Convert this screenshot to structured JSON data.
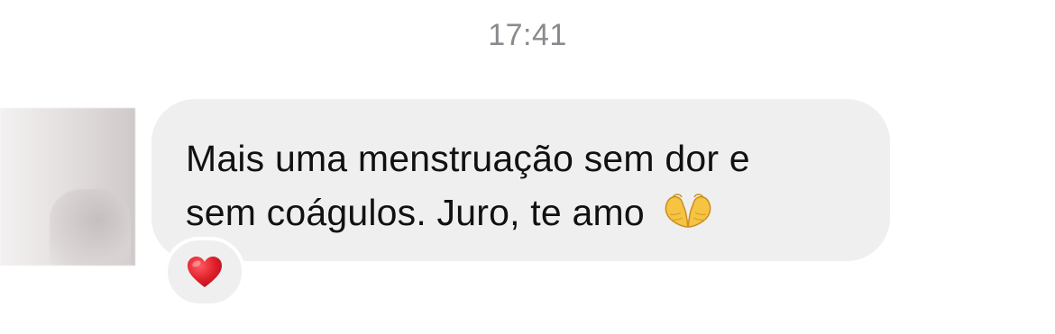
{
  "header": {
    "timestamp": "17:41"
  },
  "message": {
    "line1": "Mais uma menstruação sem dor e",
    "line2": "sem coágulos. Juro, te amo",
    "emoji": "heart-hands-icon"
  },
  "reaction": {
    "emoji": "red-heart-icon",
    "color": "#e0202b"
  },
  "colors": {
    "bubble": "#efefef",
    "timestamp": "#8a8a8e"
  }
}
